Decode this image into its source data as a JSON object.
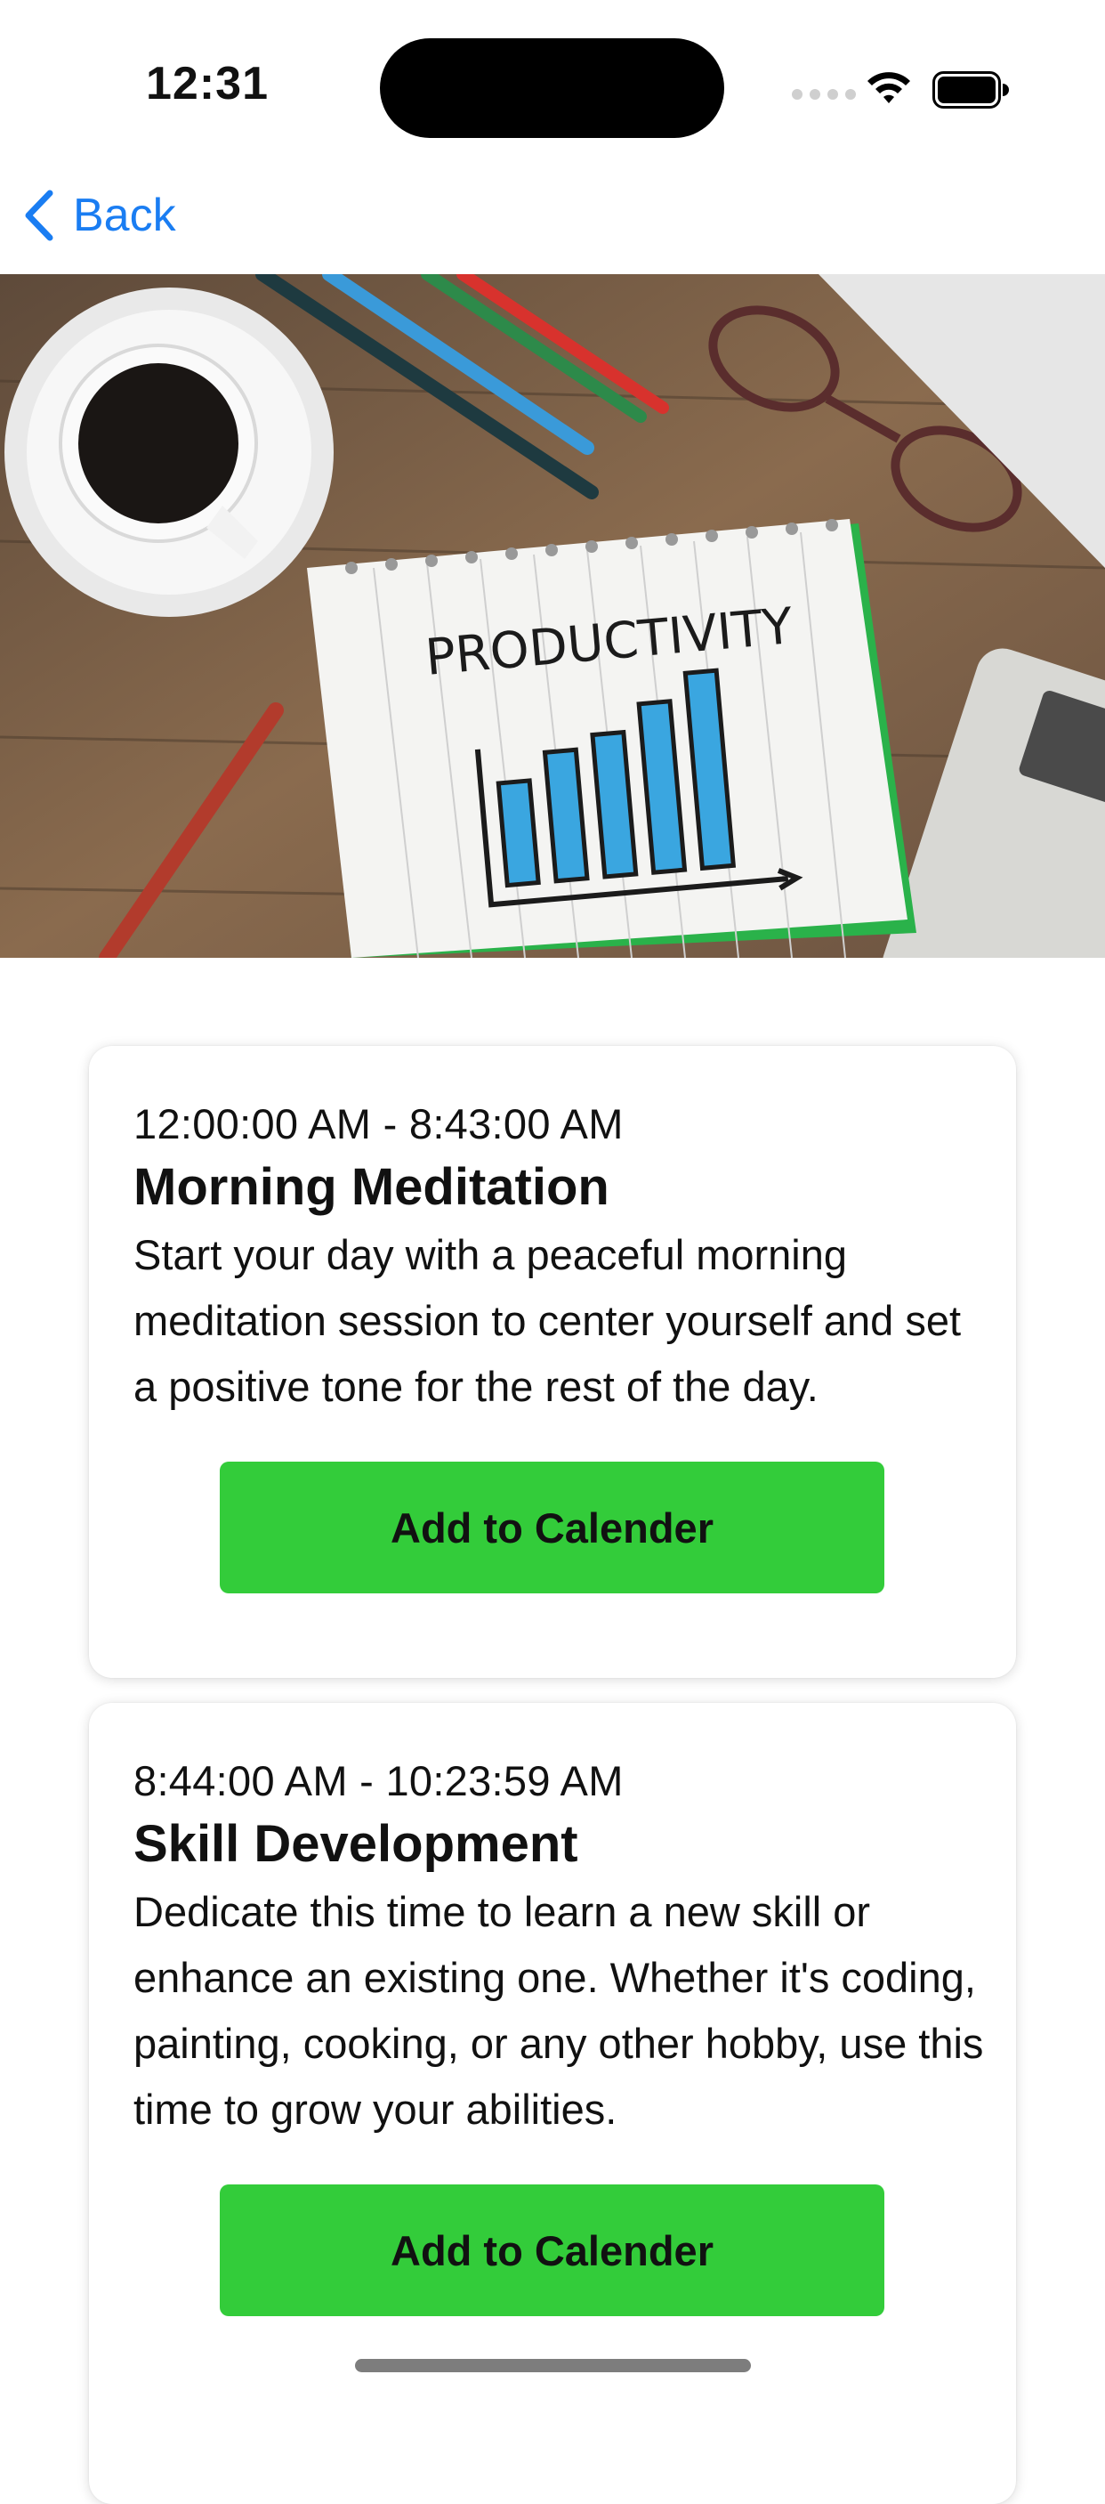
{
  "status_bar": {
    "time": "12:31",
    "icons": [
      "signal-dots-icon",
      "wifi-icon",
      "battery-icon"
    ]
  },
  "nav": {
    "back_label": "Back",
    "back_icon": "chevron-left-icon"
  },
  "hero": {
    "notebook_heading": "PRODUCTIVITY"
  },
  "colors": {
    "accent": "#1a7df2",
    "button": "#33cc3a",
    "background": "#ffffff"
  },
  "cards": [
    {
      "time_range": "12:00:00 AM - 8:43:00 AM",
      "title": "Morning Meditation",
      "description": "Start your day with a peaceful morning meditation session to center yourself and set a positive tone for the rest of the day.",
      "button_label": "Add to Calender"
    },
    {
      "time_range": "8:44:00 AM - 10:23:59 AM",
      "title": "Skill Development",
      "description": "Dedicate this time to learn a new skill or enhance an existing one. Whether it's coding, painting, cooking, or any other hobby, use this time to grow your abilities.",
      "button_label": "Add to Calender"
    }
  ]
}
